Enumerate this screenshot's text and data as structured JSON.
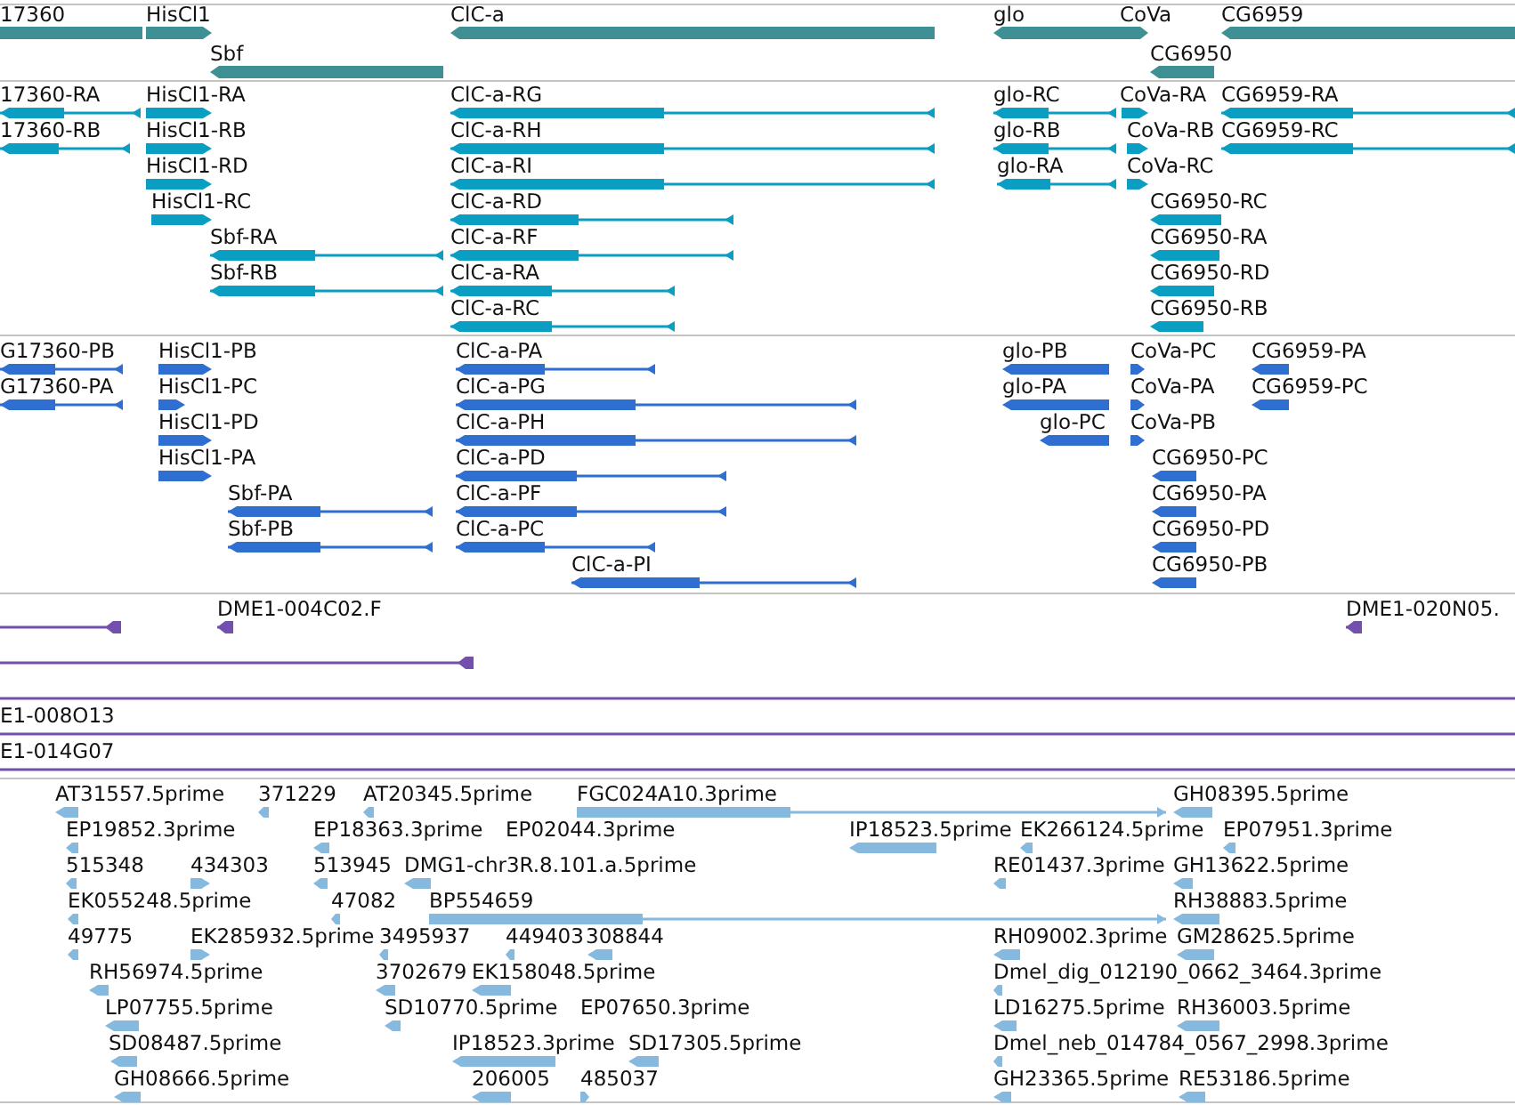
{
  "tracks": [
    {
      "kind": "gene",
      "features": [
        {
          "label": "17360",
          "clipped": true
        },
        {
          "label": "HisCl1",
          "points_left": false
        },
        {
          "label": "Sbf",
          "points_left": true
        },
        {
          "label": "ClC-a",
          "points_left": true
        },
        {
          "label": "glo",
          "points_left": true
        },
        {
          "label": "CoVa",
          "points_left": false
        },
        {
          "label": "CG6959",
          "points_left": true
        },
        {
          "label": "CG6950",
          "points_left": true
        }
      ]
    },
    {
      "kind": "transcript",
      "features": [
        {
          "label": "17360-RA",
          "points_left": true
        },
        {
          "label": "17360-RB",
          "points_left": true
        },
        {
          "label": "HisCl1-RA",
          "points_left": false
        },
        {
          "label": "HisCl1-RB",
          "points_left": false
        },
        {
          "label": "HisCl1-RD",
          "points_left": false
        },
        {
          "label": "HisCl1-RC",
          "points_left": false
        },
        {
          "label": "Sbf-RA",
          "points_left": true
        },
        {
          "label": "Sbf-RB",
          "points_left": true
        },
        {
          "label": "ClC-a-RG",
          "points_left": true
        },
        {
          "label": "ClC-a-RH",
          "points_left": true
        },
        {
          "label": "ClC-a-RI",
          "points_left": true
        },
        {
          "label": "ClC-a-RD",
          "points_left": true
        },
        {
          "label": "ClC-a-RF",
          "points_left": true
        },
        {
          "label": "ClC-a-RA",
          "points_left": true
        },
        {
          "label": "ClC-a-RC",
          "points_left": true
        },
        {
          "label": "glo-RC",
          "points_left": true
        },
        {
          "label": "glo-RB",
          "points_left": true
        },
        {
          "label": "glo-RA",
          "points_left": true
        },
        {
          "label": "CoVa-RA",
          "points_left": false
        },
        {
          "label": "CoVa-RB",
          "points_left": false
        },
        {
          "label": "CoVa-RC",
          "points_left": false
        },
        {
          "label": "CG6959-RA",
          "points_left": true
        },
        {
          "label": "CG6959-RC",
          "points_left": true
        },
        {
          "label": "CG6950-RC",
          "points_left": true
        },
        {
          "label": "CG6950-RA",
          "points_left": true
        },
        {
          "label": "CG6950-RD",
          "points_left": true
        },
        {
          "label": "CG6950-RB",
          "points_left": true
        }
      ]
    },
    {
      "kind": "protein",
      "features": [
        {
          "label": "G17360-PB",
          "points_left": true
        },
        {
          "label": "G17360-PA",
          "points_left": true
        },
        {
          "label": "HisCl1-PB",
          "points_left": false
        },
        {
          "label": "HisCl1-PC",
          "points_left": false
        },
        {
          "label": "HisCl1-PD",
          "points_left": false
        },
        {
          "label": "HisCl1-PA",
          "points_left": false
        },
        {
          "label": "Sbf-PA",
          "points_left": true
        },
        {
          "label": "Sbf-PB",
          "points_left": true
        },
        {
          "label": "ClC-a-PA",
          "points_left": true
        },
        {
          "label": "ClC-a-PG",
          "points_left": true
        },
        {
          "label": "ClC-a-PH",
          "points_left": true
        },
        {
          "label": "ClC-a-PD",
          "points_left": true
        },
        {
          "label": "ClC-a-PF",
          "points_left": true
        },
        {
          "label": "ClC-a-PC",
          "points_left": true
        },
        {
          "label": "ClC-a-PI",
          "points_left": true
        },
        {
          "label": "glo-PB",
          "points_left": true
        },
        {
          "label": "glo-PA",
          "points_left": true
        },
        {
          "label": "glo-PC",
          "points_left": true
        },
        {
          "label": "CoVa-PC",
          "points_left": false
        },
        {
          "label": "CoVa-PA",
          "points_left": false
        },
        {
          "label": "CoVa-PB",
          "points_left": false
        },
        {
          "label": "CG6959-PA",
          "points_left": true
        },
        {
          "label": "CG6959-PC",
          "points_left": true
        },
        {
          "label": "CG6950-PC",
          "points_left": true
        },
        {
          "label": "CG6950-PA",
          "points_left": true
        },
        {
          "label": "CG6950-PD",
          "points_left": true
        },
        {
          "label": "CG6950-PB",
          "points_left": true
        }
      ]
    },
    {
      "kind": "clone",
      "features": [
        {
          "points_left": true
        },
        {
          "label": "DME1-004C02.F",
          "points_left": true
        },
        {
          "label": "DME1-020N05.",
          "points_left": true
        },
        {
          "points_left": true
        },
        {
          "clipped": true
        },
        {
          "label": "E1-008O13",
          "clipped": true
        },
        {
          "label": "E1-014G07",
          "clipped": true
        }
      ]
    },
    {
      "kind": "est",
      "features": [
        {
          "label": "AT31557.5prime",
          "points_left": true
        },
        {
          "label": "371229",
          "points_left": true
        },
        {
          "label": "AT20345.5prime",
          "points_left": true
        },
        {
          "label": "FGC024A10.3prime",
          "points_left": false
        },
        {
          "label": "GH08395.5prime",
          "points_left": true
        },
        {
          "label": "EP19852.3prime",
          "points_left": true
        },
        {
          "label": "EP18363.3prime",
          "points_left": true
        },
        {
          "label": "EP02044.3prime"
        },
        {
          "label": "IP18523.5prime",
          "points_left": true
        },
        {
          "label": "EK266124.5prime",
          "points_left": true
        },
        {
          "label": "EP07951.3prime",
          "points_left": true
        },
        {
          "label": "515348",
          "points_left": true
        },
        {
          "label": "434303",
          "points_left": false
        },
        {
          "label": "513945",
          "points_left": true
        },
        {
          "label": "DMG1-chr3R.8.101.a.5prime",
          "points_left": true
        },
        {
          "label": "RE01437.3prime",
          "points_left": true
        },
        {
          "label": "GH13622.5prime",
          "points_left": true
        },
        {
          "label": "EK055248.5prime",
          "points_left": true
        },
        {
          "label": "47082",
          "points_left": true
        },
        {
          "label": "BP554659",
          "points_left": false
        },
        {
          "label": "RH38883.5prime",
          "points_left": true
        },
        {
          "label": "49775",
          "points_left": true
        },
        {
          "label": "EK285932.5prime",
          "points_left": false
        },
        {
          "label": "3495937",
          "points_left": true
        },
        {
          "label": "449403",
          "points_left": true
        },
        {
          "label": "308844",
          "points_left": true
        },
        {
          "label": "RH09002.3prime",
          "points_left": true
        },
        {
          "label": "GM28625.5prime",
          "points_left": true
        },
        {
          "label": "RH56974.5prime",
          "points_left": true
        },
        {
          "label": "3702679",
          "points_left": true
        },
        {
          "label": "EK158048.5prime",
          "points_left": true
        },
        {
          "label": "Dmel_dig_012190_0662_3464.3prime",
          "points_left": true
        },
        {
          "label": "LP07755.5prime",
          "points_left": true
        },
        {
          "label": "SD10770.5prime",
          "points_left": true
        },
        {
          "label": "EP07650.3prime"
        },
        {
          "label": "LD16275.5prime",
          "points_left": true
        },
        {
          "label": "RH36003.5prime",
          "points_left": true
        },
        {
          "label": "SD08487.5prime",
          "points_left": true
        },
        {
          "label": "IP18523.3prime",
          "points_left": true
        },
        {
          "label": "SD17305.5prime",
          "points_left": true
        },
        {
          "label": "Dmel_neb_014784_0567_2998.3prime",
          "points_left": true
        },
        {
          "label": "GH08666.5prime",
          "points_left": true
        },
        {
          "label": "206005",
          "points_left": true
        },
        {
          "label": "485037",
          "points_left": false
        },
        {
          "label": "GH23365.5prime",
          "points_left": true
        },
        {
          "label": "RE53186.5prime",
          "points_left": true
        }
      ]
    }
  ]
}
